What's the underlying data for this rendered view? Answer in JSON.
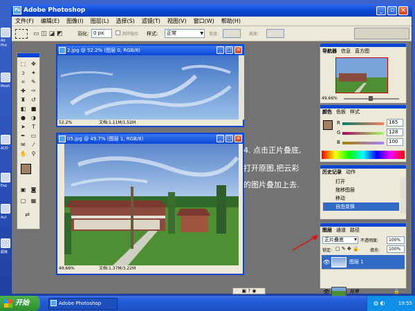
{
  "app_title": "Adobe Photoshop",
  "menu": [
    "文件(F)",
    "编辑(E)",
    "图像(I)",
    "图层(L)",
    "选择(S)",
    "滤镜(T)",
    "视图(V)",
    "窗口(W)",
    "帮助(H)"
  ],
  "options": {
    "feather_label": "羽化:",
    "feather_value": "0 px",
    "antialias_label": "消除锯齿",
    "style_label": "样式:",
    "style_value": "正常",
    "width_label": "宽度:",
    "height_label": "高度:"
  },
  "doc1": {
    "title": "2.jpg @ 52.2% (图层 0, RGB/8)",
    "zoom": "52.2%",
    "info": "文档:1.11M/1.52M"
  },
  "doc2": {
    "title": "05.jpg @ 49.7% (图层 1, RGB/8)",
    "zoom": "49.66%",
    "info": "文档:1.37M/3.22M"
  },
  "navigator": {
    "tabs": [
      "导航器",
      "信息",
      "直方图"
    ],
    "zoom": "49.66%"
  },
  "color": {
    "tabs": [
      "颜色",
      "色板",
      "样式"
    ],
    "r_label": "R",
    "g_label": "G",
    "b_label": "B",
    "r": "165",
    "g": "128",
    "b": "100",
    "swatch": "#a58064"
  },
  "history": {
    "tabs": [
      "历史记录",
      "动作"
    ],
    "items": [
      "打开",
      "拖移图层",
      "移动",
      "自由变换"
    ]
  },
  "layers": {
    "tabs": [
      "图层",
      "通道",
      "路径"
    ],
    "blend_mode": "正片叠底",
    "opacity_label": "不透明度:",
    "opacity": "100%",
    "lock_label": "锁定:",
    "fill_label": "填充:",
    "fill": "100%",
    "items": [
      "图层 1",
      "背景"
    ]
  },
  "note_lines": [
    "4. 点击正片叠底,",
    "打开原图,把云彩",
    "的图片叠加上去."
  ],
  "taskbar": {
    "start": "开始",
    "task": "Adobe Photoshop",
    "clock": "19:55"
  },
  "desktop_labels": [
    "Ad",
    "Pho",
    "Mesh",
    "ACD",
    "Exp",
    "Aut",
    "超级"
  ],
  "colors": {
    "titlebar": "#0a46d6",
    "selection": "#316ac5",
    "workspace": "#737373"
  }
}
